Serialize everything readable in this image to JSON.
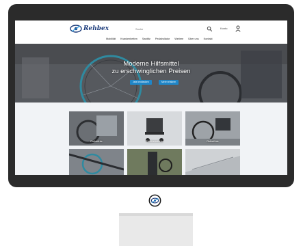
{
  "header": {
    "logo_text": "Rehbex",
    "search_placeholder": "Suche",
    "account_label": "Konto",
    "nav": [
      "Mobilität",
      "Krankenbetten",
      "Sanitär",
      "Pedalrollator",
      "Weitere",
      "Über uns",
      "Kontakt"
    ]
  },
  "hero": {
    "title_line1": "Moderne Hilfsmittel",
    "title_line2": "zu erschwinglichen Preisen",
    "button_primary": "Jetzt entdecken",
    "button_secondary": "Mehr erfahren"
  },
  "categories": [
    {
      "label": "Rollstühle"
    },
    {
      "label": "Toilettenstühle"
    },
    {
      "label": "Rollstühle"
    },
    {
      "label": ""
    },
    {
      "label": ""
    },
    {
      "label": ""
    }
  ],
  "colors": {
    "accent": "#1f86c8",
    "brand": "#1a3a7a",
    "frame": "#2b2b2b"
  },
  "icons": [
    "logo-icon",
    "search-icon",
    "user-icon",
    "brand-badge-icon"
  ]
}
